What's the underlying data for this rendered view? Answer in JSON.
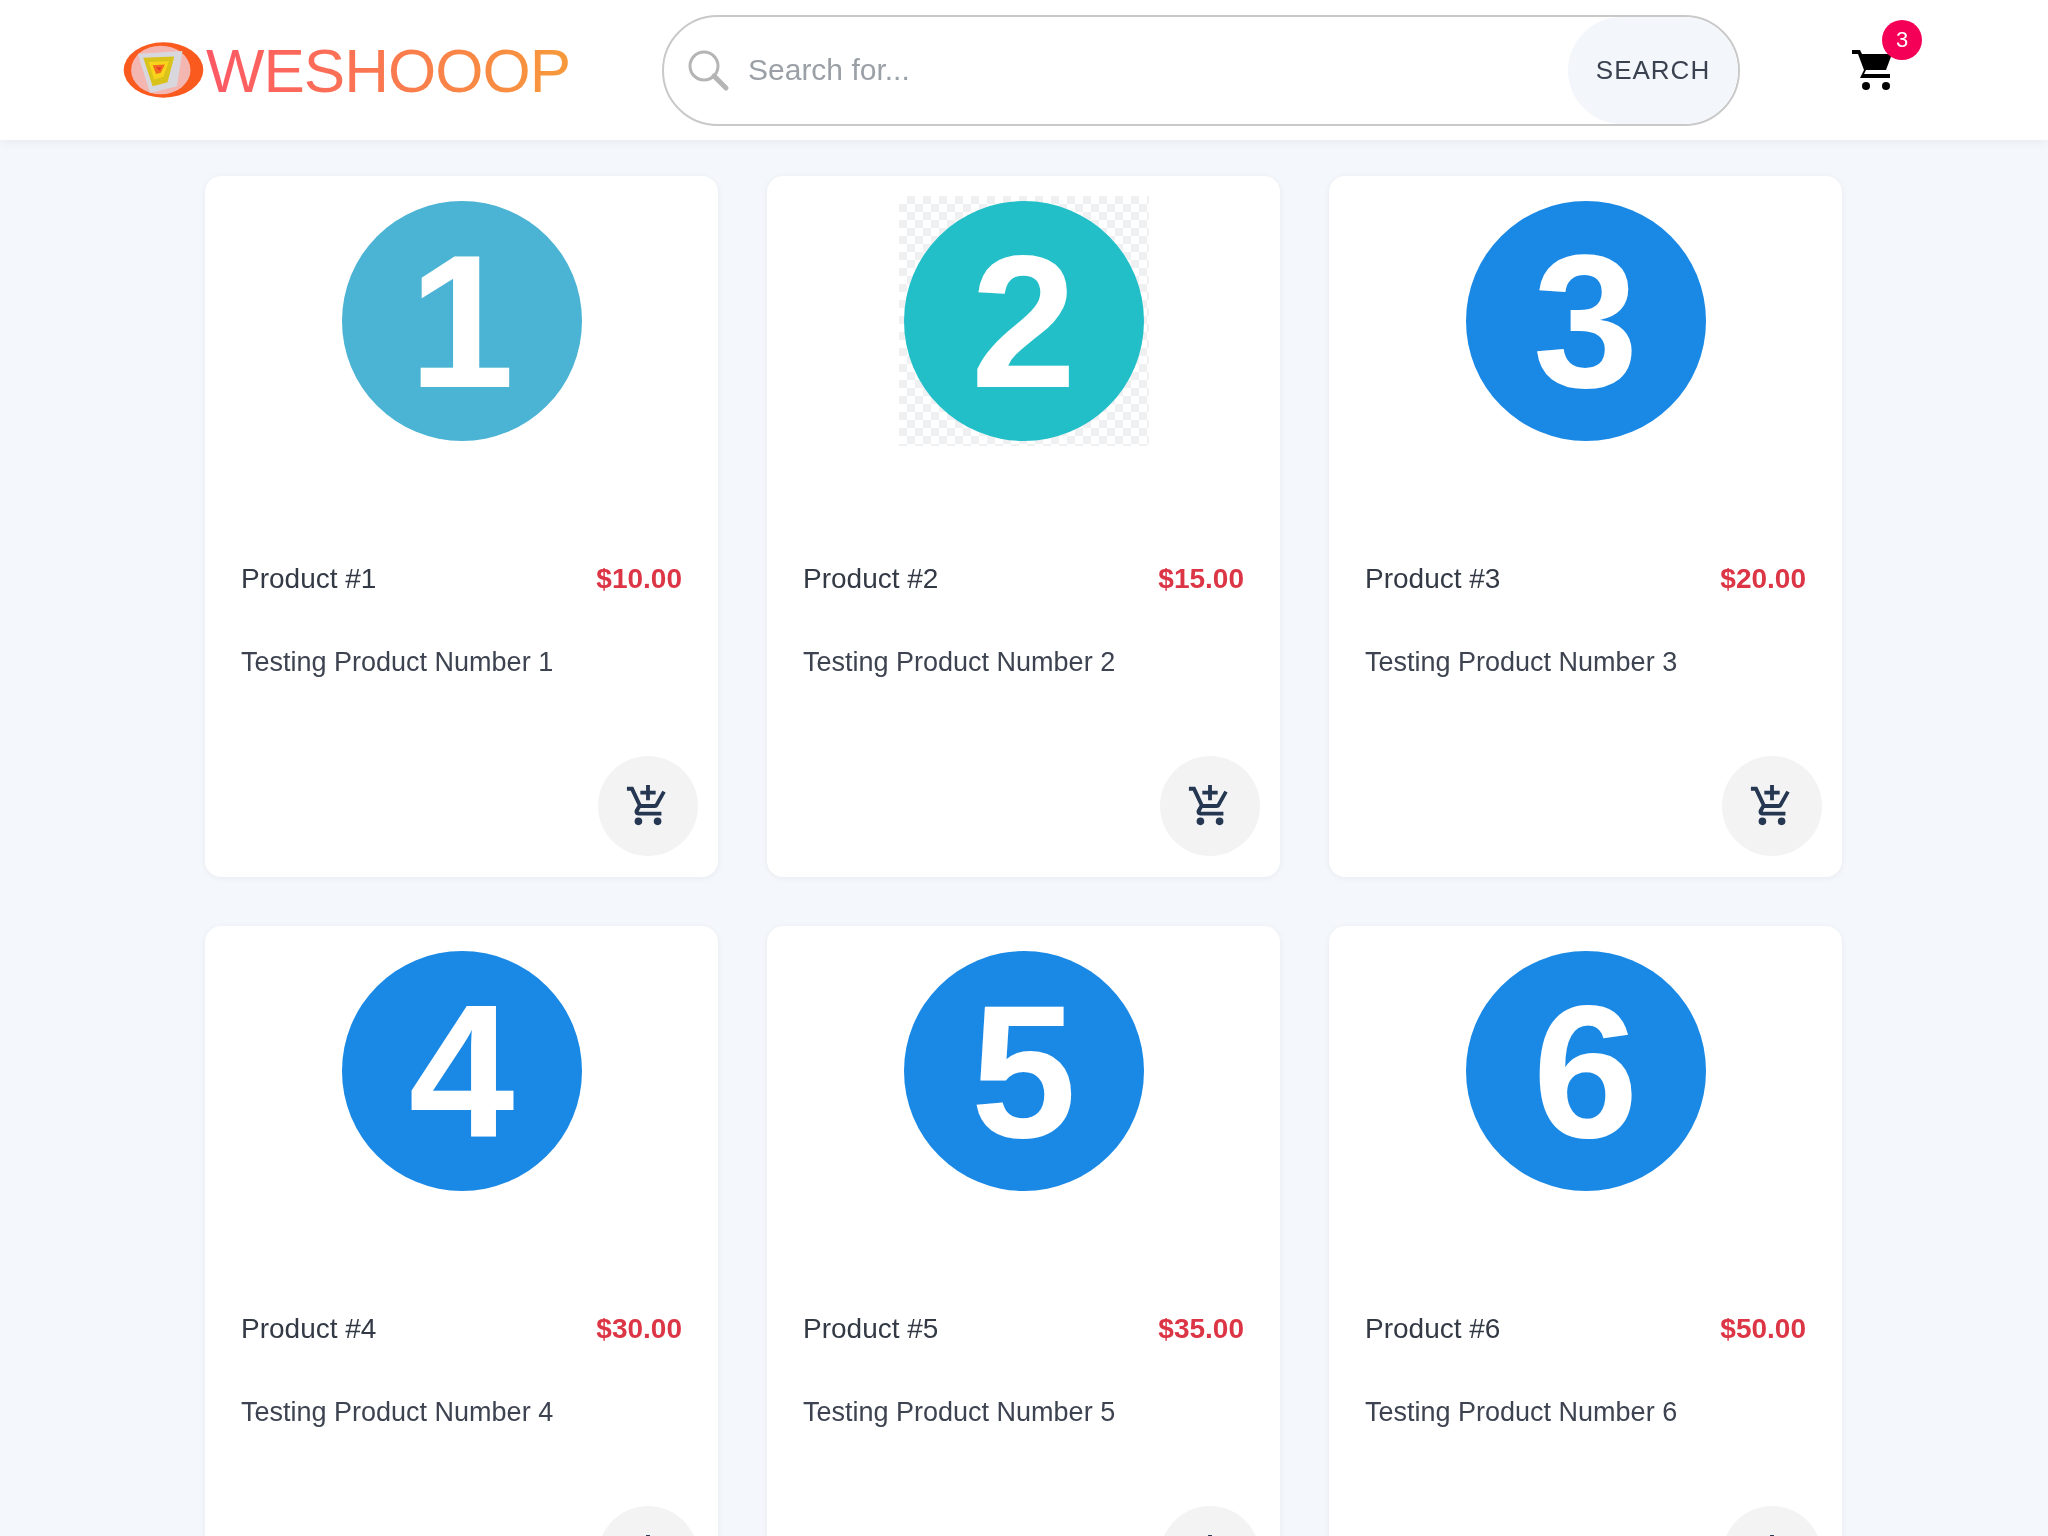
{
  "header": {
    "logo": "WESHOOOP",
    "search": {
      "placeholder": "Search for...",
      "button": "SEARCH"
    },
    "cart_count": "3"
  },
  "products": [
    {
      "image_number": "1",
      "color": "#4bb3d3",
      "transparent_background": false,
      "name": "Product #1",
      "price": "$10.00",
      "description": "Testing Product Number 1"
    },
    {
      "image_number": "2",
      "color": "#22bfc9",
      "transparent_background": true,
      "name": "Product #2",
      "price": "$15.00",
      "description": "Testing Product Number 2"
    },
    {
      "image_number": "3",
      "color": "#1a88e5",
      "transparent_background": false,
      "name": "Product #3",
      "price": "$20.00",
      "description": "Testing Product Number 3"
    },
    {
      "image_number": "4",
      "color": "#1a88e5",
      "transparent_background": false,
      "name": "Product #4",
      "price": "$30.00",
      "description": "Testing Product Number 4"
    },
    {
      "image_number": "5",
      "color": "#1a88e5",
      "transparent_background": false,
      "name": "Product #5",
      "price": "$35.00",
      "description": "Testing Product Number 5"
    },
    {
      "image_number": "6",
      "color": "#1a88e5",
      "transparent_background": false,
      "name": "Product #6",
      "price": "$50.00",
      "description": "Testing Product Number 6"
    }
  ]
}
